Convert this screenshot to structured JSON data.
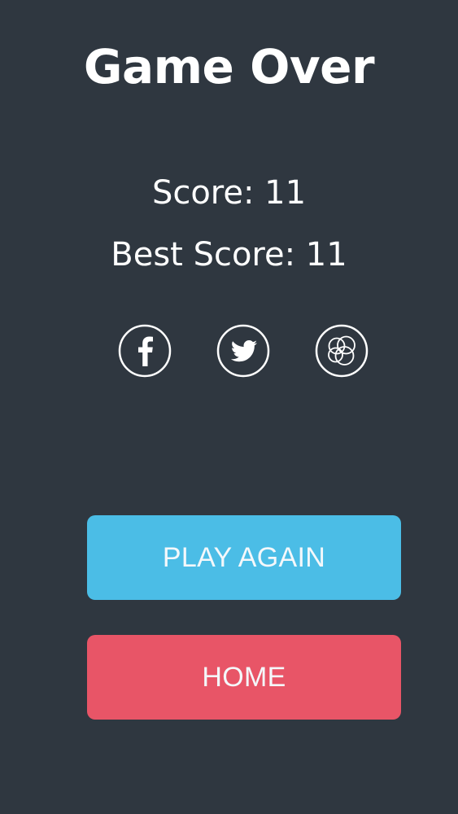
{
  "screen": {
    "title": "Game Over",
    "background_color": "#2f3740"
  },
  "scores": {
    "score_text": "Score: 11",
    "best_score_text": "Best Score: 11",
    "score": 11,
    "best_score": 11
  },
  "social": {
    "icons": [
      "facebook-icon",
      "twitter-icon",
      "game-center-icon"
    ]
  },
  "buttons": {
    "play_again_label": "PLAY AGAIN",
    "play_again_color": "#4bbde6",
    "home_label": "HOME",
    "home_color": "#e85567"
  }
}
